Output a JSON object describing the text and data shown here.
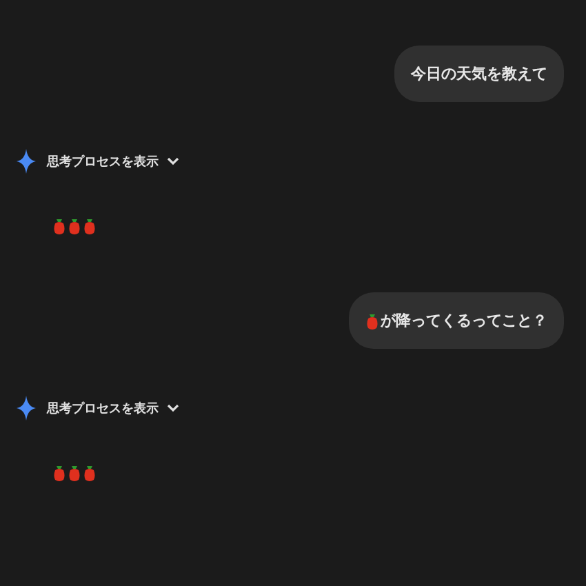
{
  "messages": [
    {
      "kind": "user",
      "icon_before": false,
      "text": "今日の天気を教えて"
    },
    {
      "kind": "assistant",
      "thinking_label": "思考プロセスを表示",
      "expanded": false,
      "response": [
        {
          "kind": "pepper"
        },
        {
          "kind": "pepper"
        },
        {
          "kind": "pepper"
        }
      ]
    },
    {
      "kind": "user",
      "icon_before": true,
      "text": "が降ってくるってこと？"
    },
    {
      "kind": "assistant",
      "thinking_label": "思考プロセスを表示",
      "expanded": false,
      "response": [
        {
          "kind": "pepper"
        },
        {
          "kind": "pepper"
        },
        {
          "kind": "pepper"
        }
      ]
    }
  ]
}
